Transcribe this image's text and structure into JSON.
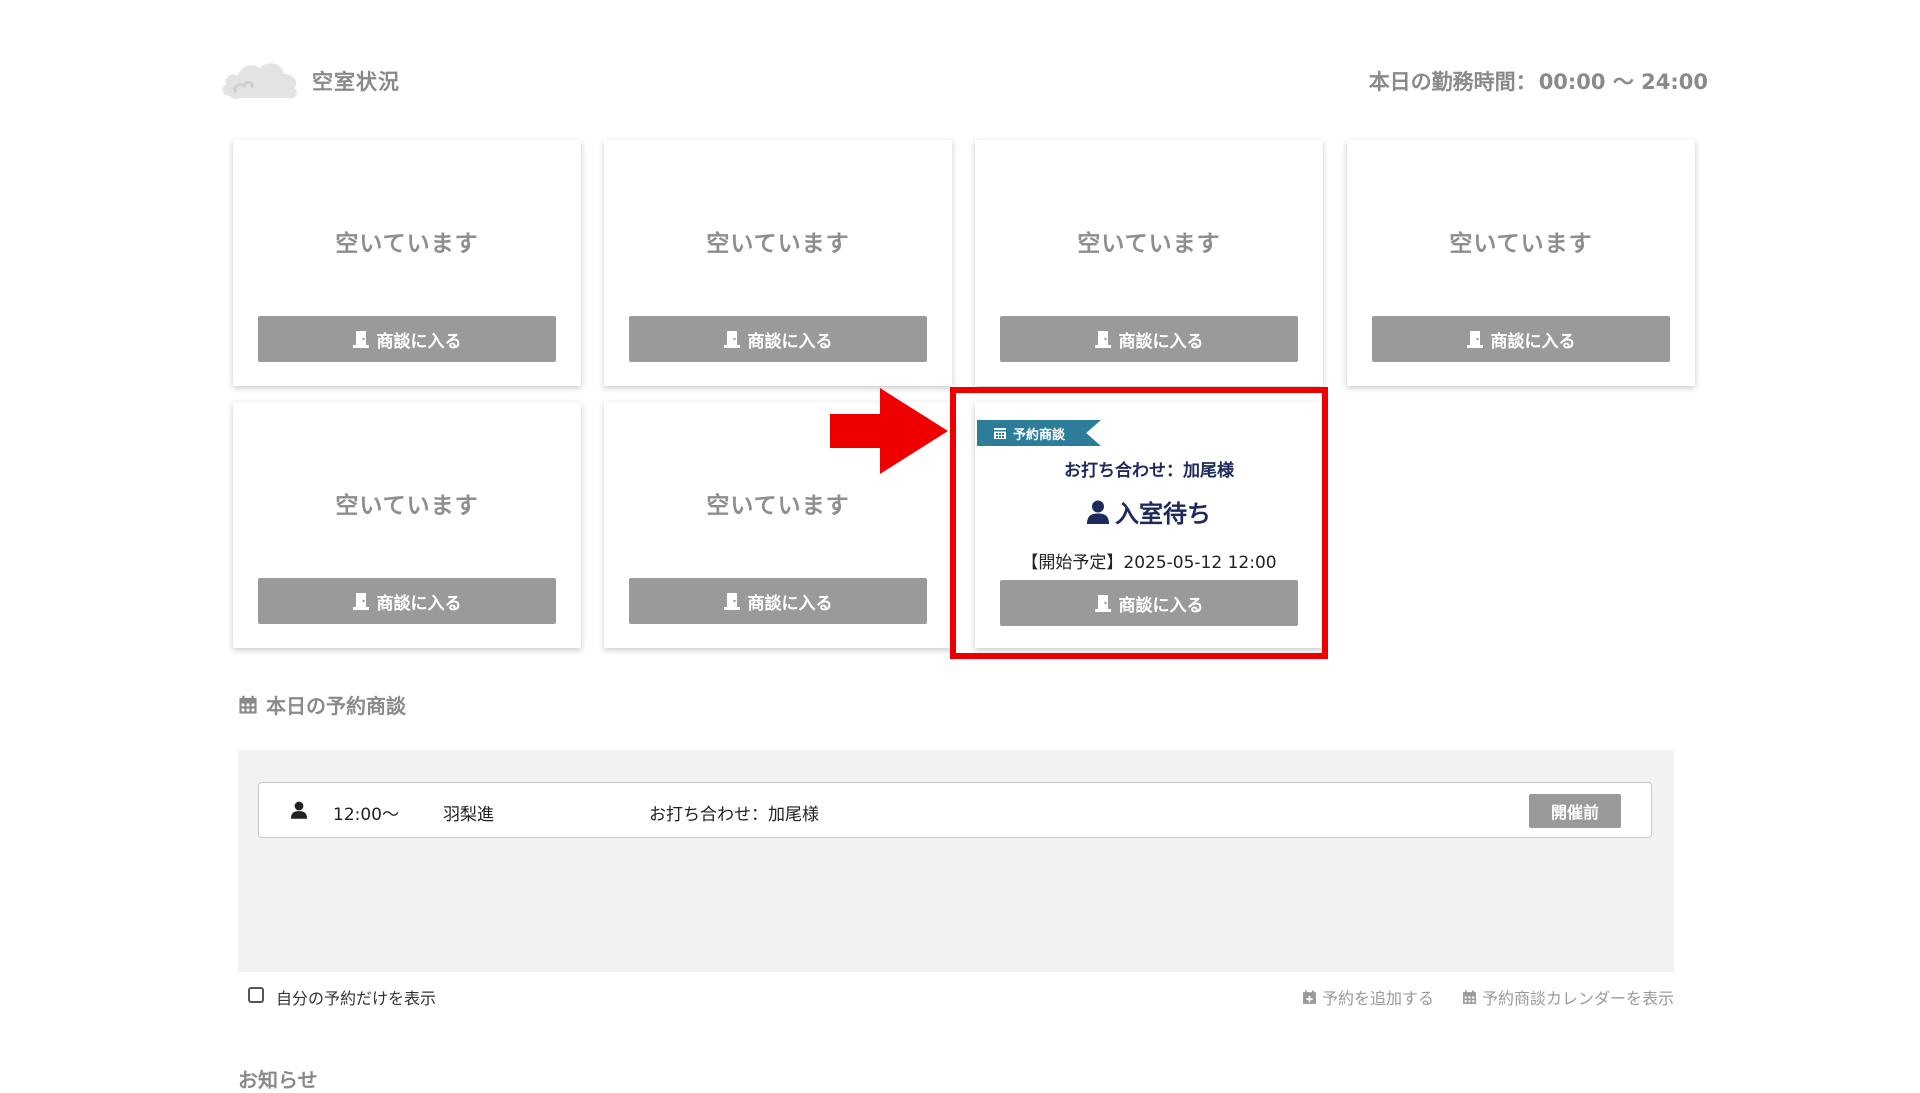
{
  "header": {
    "title": "空室状況",
    "work_hours_label": "本日の勤務時間：",
    "work_hours_value": "00:00 〜 24:00"
  },
  "rooms": [
    {
      "status": "空いています",
      "button": "商談に入る"
    },
    {
      "status": "空いています",
      "button": "商談に入る"
    },
    {
      "status": "空いています",
      "button": "商談に入る"
    },
    {
      "status": "空いています",
      "button": "商談に入る"
    },
    {
      "status": "空いています",
      "button": "商談に入る"
    },
    {
      "status": "空いています",
      "button": "商談に入る"
    },
    {
      "ribbon": "予約商談",
      "meeting_name": "お打ち合わせ：加尾様",
      "status": "入室待ち",
      "scheduled_start": "【開始予定】2025-05-12 12:00",
      "button": "商談に入る"
    }
  ],
  "today_reservations": {
    "title": "本日の予約商談",
    "rows": [
      {
        "time": "12:00〜",
        "host": "羽梨進",
        "title": "お打ち合わせ：加尾様",
        "status": "開催前"
      }
    ]
  },
  "footer": {
    "only_mine_label": "自分の予約だけを表示",
    "add_reservation": "予約を追加する",
    "show_calendar": "予約商談カレンダーを表示"
  },
  "next_section_title": "お知らせ",
  "colors": {
    "ribbon": "#2d7d9a",
    "highlight": "#ee0000",
    "button": "#9a9a9a",
    "navy_text": "#1e2a5c"
  }
}
